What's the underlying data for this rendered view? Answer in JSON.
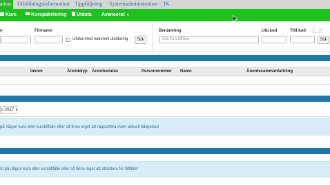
{
  "tabs": [
    {
      "label": "ation",
      "active": true
    },
    {
      "label": "Utbildningsinformation",
      "active": false
    },
    {
      "label": "Uppföljning",
      "active": false
    },
    {
      "label": "Systemadministration",
      "active": false
    },
    {
      "label": "IK",
      "active": false
    }
  ],
  "nav": {
    "kurs": "Kurs",
    "kurspaketering": "Kurspaketering",
    "utdata": "Utdata",
    "avancerat": "Avancerat"
  },
  "search": {
    "col1_label": "n",
    "fornamn_label": "Förnamn",
    "national_label": "Utöka med nationell utsökning",
    "sok1": "Sök",
    "benamning_label": "Benämning",
    "benamning_placeholder": "Sök kurstillfälle",
    "utbkod_label": "Utb.kod",
    "tillfkod_label": "Tillf.kod",
    "sok2": "Sök",
    "watermark": "La"
  },
  "table": {
    "headers": [
      "Inkom",
      "Ärendetyp",
      "Ärendestatus",
      "Personnummer",
      "Namn",
      "Ärendesammanfattning"
    ]
  },
  "period_select": {
    "value": "s 2017"
  },
  "info1": "på någon kurs eller kurstillfälle eller så finns inget att rapportera inom aktuell tidsperiod",
  "info2": "nt på någon kurs eller kurstillfälle eller så finns inget att attestera för tillfället",
  "colors": {
    "brand_green": "#1fc11f",
    "section_blue": "#1f78a8",
    "info_bg": "#d9edf7",
    "info_text": "#31708f"
  },
  "icons": [
    "graduation-cap-icon",
    "folder-icon",
    "file-icon",
    "caret-down-icon",
    "mouse-cursor-icon"
  ]
}
